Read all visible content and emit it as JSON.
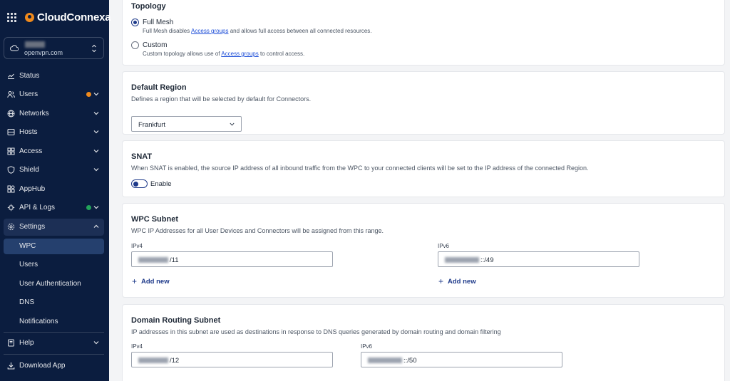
{
  "brand": {
    "name": "CloudConnexa"
  },
  "org": {
    "name_hidden": "",
    "domain": "openvpn.com"
  },
  "nav": {
    "status": "Status",
    "users": "Users",
    "networks": "Networks",
    "hosts": "Hosts",
    "access": "Access",
    "shield": "Shield",
    "apphub": "AppHub",
    "api_logs": "API & Logs",
    "settings": "Settings",
    "settings_sub": {
      "wpc": "WPC",
      "users": "Users",
      "user_auth": "User Authentication",
      "dns": "DNS",
      "notifications": "Notifications"
    },
    "help": "Help",
    "download": "Download App"
  },
  "colors": {
    "users_badge": "#f08a1c",
    "api_badge": "#22a35a",
    "accent": "#1e3a8a"
  },
  "topology": {
    "title": "Topology",
    "full_mesh": {
      "label": "Full Mesh",
      "help_pre": "Full Mesh disables ",
      "help_link": "Access groups",
      "help_post": " and allows full access between all connected resources."
    },
    "custom": {
      "label": "Custom",
      "help_pre": "Custom topology allows use of ",
      "help_link": "Access groups",
      "help_post": " to control access."
    }
  },
  "default_region": {
    "title": "Default Region",
    "desc": "Defines a region that will be selected by default for Connectors.",
    "value": "Frankfurt"
  },
  "snat": {
    "title": "SNAT",
    "desc": "When SNAT is enabled, the source IP address of all inbound traffic from the WPC to your connected clients will be set to the IP address of the connected Region.",
    "toggle_label": "Enable"
  },
  "wpc_subnet": {
    "title": "WPC Subnet",
    "desc": "WPC IP Addresses for all User Devices and Connectors will be assigned from this range.",
    "ipv4_label": "IPv4",
    "ipv4_suffix": "/11",
    "ipv6_label": "IPv6",
    "ipv6_suffix": "::/49",
    "add_new": "Add new"
  },
  "domain_routing": {
    "title": "Domain Routing Subnet",
    "desc": "IP addresses in this subnet are used as destinations in response to DNS queries generated by domain routing and domain filtering",
    "ipv4_label": "IPv4",
    "ipv4_suffix": "/12",
    "ipv6_label": "IPv6",
    "ipv6_suffix": "::/50"
  }
}
